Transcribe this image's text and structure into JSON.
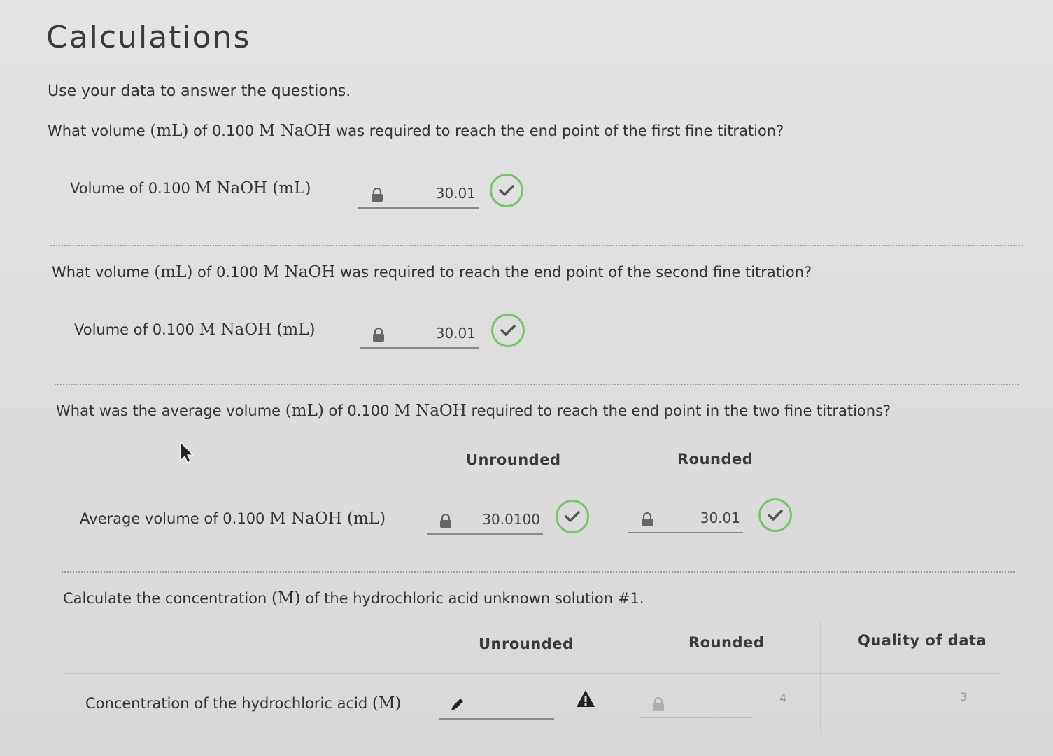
{
  "page": {
    "title": "Calculations",
    "intro": "Use your data to answer the questions."
  },
  "q1": {
    "question_pre": "What volume ",
    "question_unit": "(mL)",
    "question_mid": " of 0.100 ",
    "question_formula": "M NaOH",
    "question_post": " was required to reach the end point of the first fine titration?",
    "label_pre": "Volume of 0.100 ",
    "label_formula": "M NaOH (mL)",
    "value": "30.01"
  },
  "q2": {
    "question_pre": "What volume ",
    "question_unit": "(mL)",
    "question_mid": " of 0.100 ",
    "question_formula": "M NaOH",
    "question_post": " was required to reach the end point of the second fine titration?",
    "label_pre": "Volume of 0.100 ",
    "label_formula": "M NaOH (mL)",
    "value": "30.01"
  },
  "q3": {
    "question_pre": "What was the average volume ",
    "question_unit": "(mL)",
    "question_mid": " of 0.100 ",
    "question_formula": "M NaOH",
    "question_post": " required to reach the end point in the two fine titrations?",
    "col_unrounded": "Unrounded",
    "col_rounded": "Rounded",
    "label_pre": "Average volume of 0.100 ",
    "label_formula": "M NaOH (mL)",
    "unrounded_value": "30.0100",
    "rounded_value": "30.01"
  },
  "q4": {
    "question_pre": "Calculate the concentration ",
    "question_unit": "(M)",
    "question_post": " of the hydrochloric acid unknown solution #1.",
    "col_unrounded": "Unrounded",
    "col_rounded": "Rounded",
    "col_quality": "Quality of data",
    "label_pre": "Concentration of the hydrochloric acid ",
    "label_unit": "(M)",
    "unrounded_value": "",
    "rounded_value": "",
    "rounded_count": "4",
    "quality_count": "3"
  },
  "colors": {
    "check_green": "#7cc36f",
    "warning_dark": "#222222",
    "lock_gray": "#666666"
  }
}
